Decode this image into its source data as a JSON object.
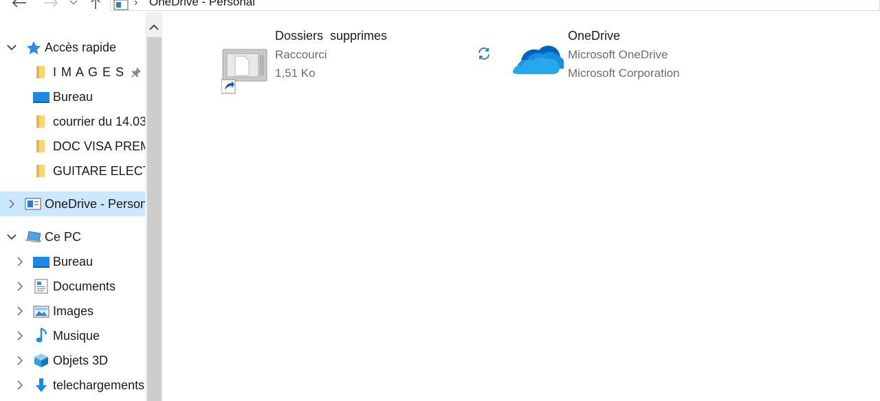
{
  "address": {
    "path": "OneDrive - Personal"
  },
  "sidebar": {
    "quick_access": {
      "label": "Accès rapide",
      "items": [
        {
          "label": "I M A G E S"
        },
        {
          "label": "Bureau"
        },
        {
          "label": "courrier du 14.03"
        },
        {
          "label": "DOC VISA PREM"
        },
        {
          "label": "GUITARE ELECTR"
        }
      ]
    },
    "onedrive": {
      "label": "OneDrive - Person"
    },
    "this_pc": {
      "label": "Ce PC",
      "items": [
        {
          "label": "Bureau"
        },
        {
          "label": "Documents"
        },
        {
          "label": "Images"
        },
        {
          "label": "Musique"
        },
        {
          "label": "Objets 3D"
        },
        {
          "label": "telechargements"
        }
      ]
    }
  },
  "files": [
    {
      "name": "Dossiers  supprimes",
      "line1": "Raccourci",
      "line2": "1,51 Ko",
      "icon": "shortcut-icon"
    },
    {
      "name": "OneDrive",
      "line1": "Microsoft OneDrive",
      "line2": "Microsoft Corporation",
      "icon": "onedrive-cloud-icon",
      "status_icon": "sync-icon"
    }
  ],
  "colors": {
    "selection": "#cce8ff",
    "onedrive_blue": "#0f78d4",
    "folder_yellow": "#f8d675"
  }
}
